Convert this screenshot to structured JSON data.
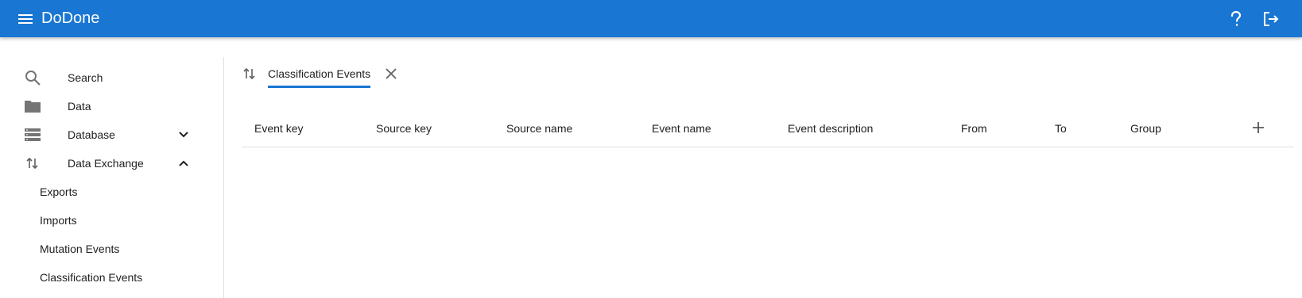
{
  "app": {
    "title": "DoDone"
  },
  "header": {
    "menu_icon": "menu-icon",
    "help_icon": "help-icon",
    "logout_icon": "logout-icon"
  },
  "sidebar": {
    "items": [
      {
        "label": "Search",
        "icon": "search-icon"
      },
      {
        "label": "Data",
        "icon": "folder-icon"
      },
      {
        "label": "Database",
        "icon": "database-icon",
        "chevron": "chevron-down-icon"
      },
      {
        "label": "Data Exchange",
        "icon": "swap-vertical-icon",
        "chevron": "chevron-up-icon"
      }
    ],
    "sub_items": [
      {
        "label": "Exports"
      },
      {
        "label": "Imports"
      },
      {
        "label": "Mutation Events"
      },
      {
        "label": "Classification Events"
      }
    ]
  },
  "tabs": [
    {
      "label": "Classification Events",
      "icon": "swap-vertical-icon",
      "active": true
    }
  ],
  "table": {
    "columns": [
      "Event key",
      "Source key",
      "Source name",
      "Event name",
      "Event description",
      "From",
      "To",
      "Group"
    ],
    "rows": [],
    "add_icon": "plus-icon"
  },
  "colors": {
    "primary": "#1976d2",
    "icon_gray": "#757575",
    "divider": "#e0e0e0"
  }
}
